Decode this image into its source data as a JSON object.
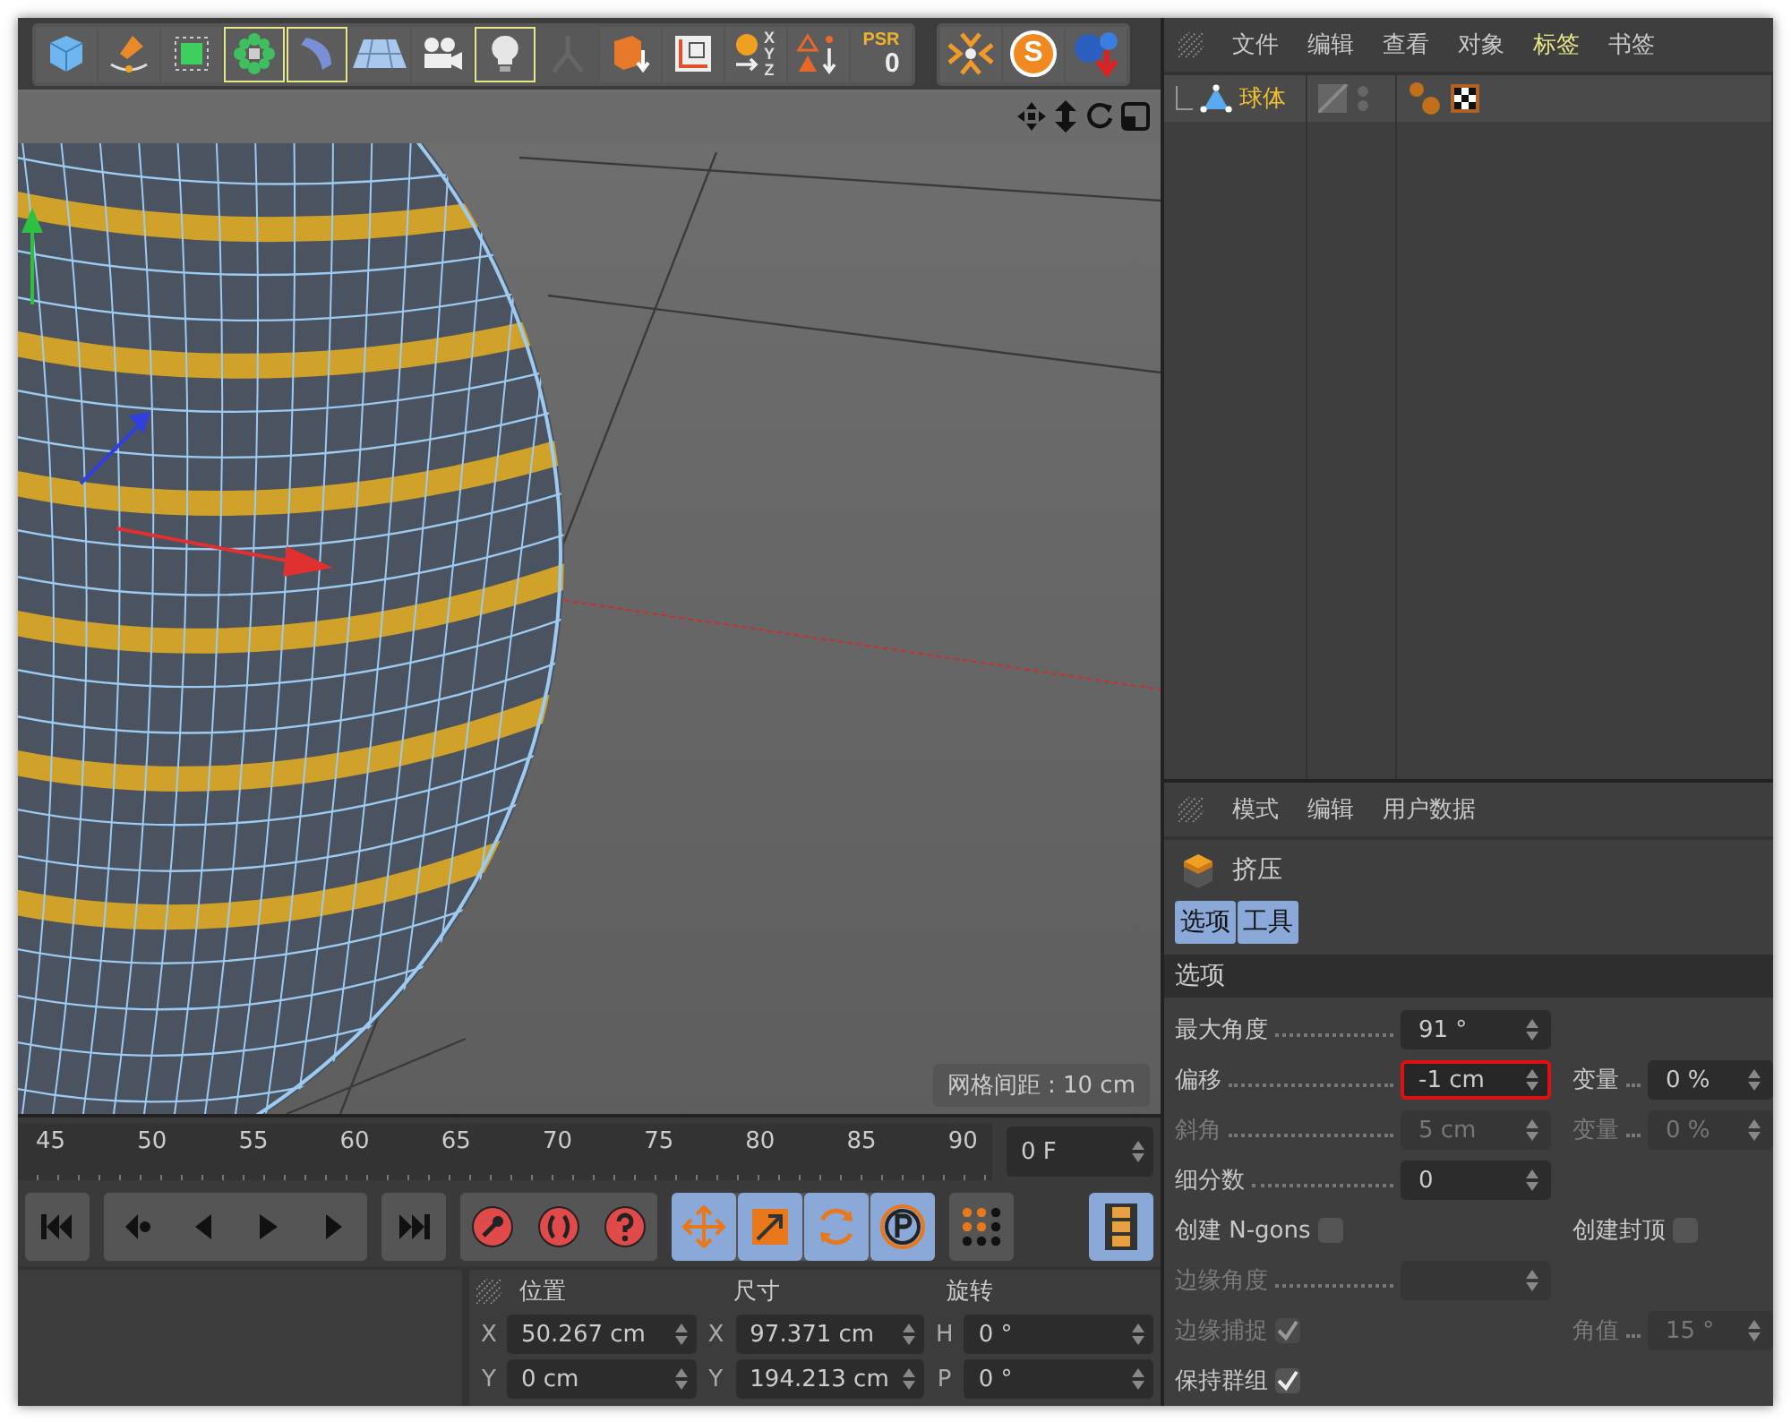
{
  "toolbar": [
    {
      "highlighted": false,
      "disabled": false
    },
    {
      "highlighted": false,
      "disabled": false
    },
    {
      "highlighted": false,
      "disabled": false
    },
    {
      "highlighted": true,
      "disabled": false
    },
    {
      "highlighted": true,
      "disabled": false
    },
    {
      "highlighted": false,
      "disabled": false
    },
    {
      "highlighted": false,
      "disabled": false
    },
    {
      "highlighted": true,
      "disabled": false
    },
    {
      "highlighted": false,
      "disabled": true
    },
    {
      "highlighted": false,
      "disabled": false
    },
    {
      "highlighted": false,
      "disabled": false
    },
    {
      "label": "XYZ",
      "highlighted": false,
      "disabled": false
    },
    {
      "highlighted": false,
      "disabled": false
    },
    {
      "label": "PSR",
      "value": "0",
      "highlighted": false,
      "disabled": false
    }
  ],
  "toolbar_right": [
    {
      "highlighted": false,
      "disabled": false
    },
    {
      "label": "S",
      "highlighted": false,
      "disabled": false
    },
    {
      "highlighted": false,
      "disabled": false
    }
  ],
  "viewport": {
    "grid_spacing": "网格间距 : 10 cm"
  },
  "timeline": {
    "ticks": [
      "45",
      "50",
      "55",
      "60",
      "65",
      "70",
      "75",
      "80",
      "85",
      "90"
    ],
    "frame": "0 F"
  },
  "object_manager": {
    "menu": [
      {
        "label": "文件",
        "selected": false
      },
      {
        "label": "编辑",
        "selected": false
      },
      {
        "label": "查看",
        "selected": false
      },
      {
        "label": "对象",
        "selected": false
      },
      {
        "label": "标签",
        "selected": true
      },
      {
        "label": "书签",
        "selected": false
      }
    ],
    "objects": [
      {
        "name": "球体",
        "selected": true
      }
    ]
  },
  "attributes": {
    "menu": [
      "模式",
      "编辑",
      "用户数据"
    ],
    "object": "挤压",
    "tabs": [
      {
        "label": "选项",
        "selected": true
      },
      {
        "label": "工具",
        "selected": true
      }
    ],
    "section": "选项",
    "params": [
      {
        "left": {
          "label": "最大角度",
          "kind": "field",
          "value": "91 °",
          "disabled": false,
          "highlighted": false
        }
      },
      {
        "left": {
          "label": "偏移",
          "kind": "field",
          "value": "-1 cm",
          "disabled": false,
          "highlighted": true
        },
        "right": {
          "label": "变量",
          "kind": "field",
          "value": "0 %",
          "disabled": false,
          "highlighted": false
        }
      },
      {
        "left": {
          "label": "斜角",
          "kind": "field",
          "value": "5 cm",
          "disabled": true,
          "highlighted": false
        },
        "right": {
          "label": "变量",
          "kind": "field",
          "value": "0 %",
          "disabled": true,
          "highlighted": false
        }
      },
      {
        "left": {
          "label": "细分数",
          "kind": "field",
          "value": "0",
          "disabled": false,
          "highlighted": false
        }
      },
      {
        "left": {
          "label": "创建 N-gons",
          "kind": "checkbox",
          "checked": false,
          "disabled": false
        },
        "right": {
          "label": "创建封顶",
          "kind": "checkbox",
          "checked": false,
          "disabled": false
        }
      },
      {
        "left": {
          "label": "边缘角度",
          "kind": "field",
          "disabled": true,
          "highlighted": false
        }
      },
      {
        "left": {
          "label": "边缘捕捉",
          "kind": "checkbox",
          "checked": true,
          "disabled": true
        },
        "right": {
          "label": "角值",
          "kind": "field",
          "value": "15 °",
          "disabled": true,
          "highlighted": false
        }
      },
      {
        "left": {
          "label": "保持群组",
          "kind": "checkbox",
          "checked": true,
          "disabled": false
        }
      }
    ]
  },
  "coordinates": {
    "headings": [
      "位置",
      "尺寸",
      "旋转"
    ],
    "rows": [
      [
        {
          "axis": "X",
          "value": "50.267 cm"
        },
        {
          "axis": "X",
          "value": "97.371 cm"
        },
        {
          "axis": "H",
          "value": "0 °"
        }
      ],
      [
        {
          "axis": "Y",
          "value": "0 cm"
        },
        {
          "axis": "Y",
          "value": "194.213 cm"
        },
        {
          "axis": "P",
          "value": "0 °"
        }
      ]
    ]
  }
}
